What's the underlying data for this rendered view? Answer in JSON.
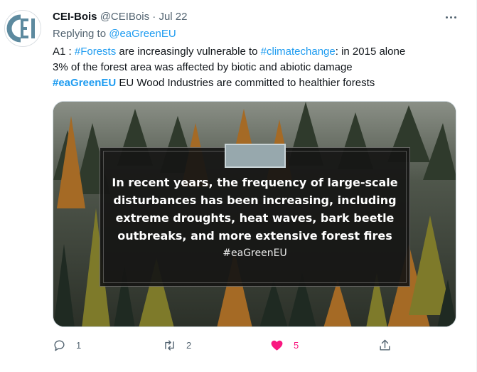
{
  "tweet": {
    "author_name": "CEI-Bois",
    "handle": "@CEIBois",
    "separator": "·",
    "date": "Jul 22",
    "reply_prefix": "Replying to",
    "reply_to": "@eaGreenEU",
    "text": {
      "l1_a": "A1 : ",
      "l1_hash1": "#Forests",
      "l1_b": " are increasingly vulnerable to ",
      "l1_hash2": "#climatechange",
      "l1_c": ": in 2015 alone",
      "l2": "3% of the forest area was affected by biotic and abiotic damage",
      "l3_hash": "#eaGreenEU",
      "l3_rest": " EU Wood Industries are committed to healthier forests"
    }
  },
  "media": {
    "quote_lines": [
      "In recent years, the frequency of large-scale",
      "disturbances has been increasing, including",
      "extreme droughts, heat waves, bark beetle",
      "outbreaks, and more extensive forest fires"
    ],
    "hashtag": "#eaGreenEU"
  },
  "actions": {
    "reply_count": "1",
    "retweet_count": "2",
    "like_count": "5",
    "like_color": "#f91880"
  },
  "icons": [
    "more-icon",
    "reply-icon",
    "retweet-icon",
    "heart-icon",
    "share-icon"
  ],
  "colors": {
    "link": "#1d9bf0",
    "muted": "#536471",
    "text": "#0f1419"
  }
}
